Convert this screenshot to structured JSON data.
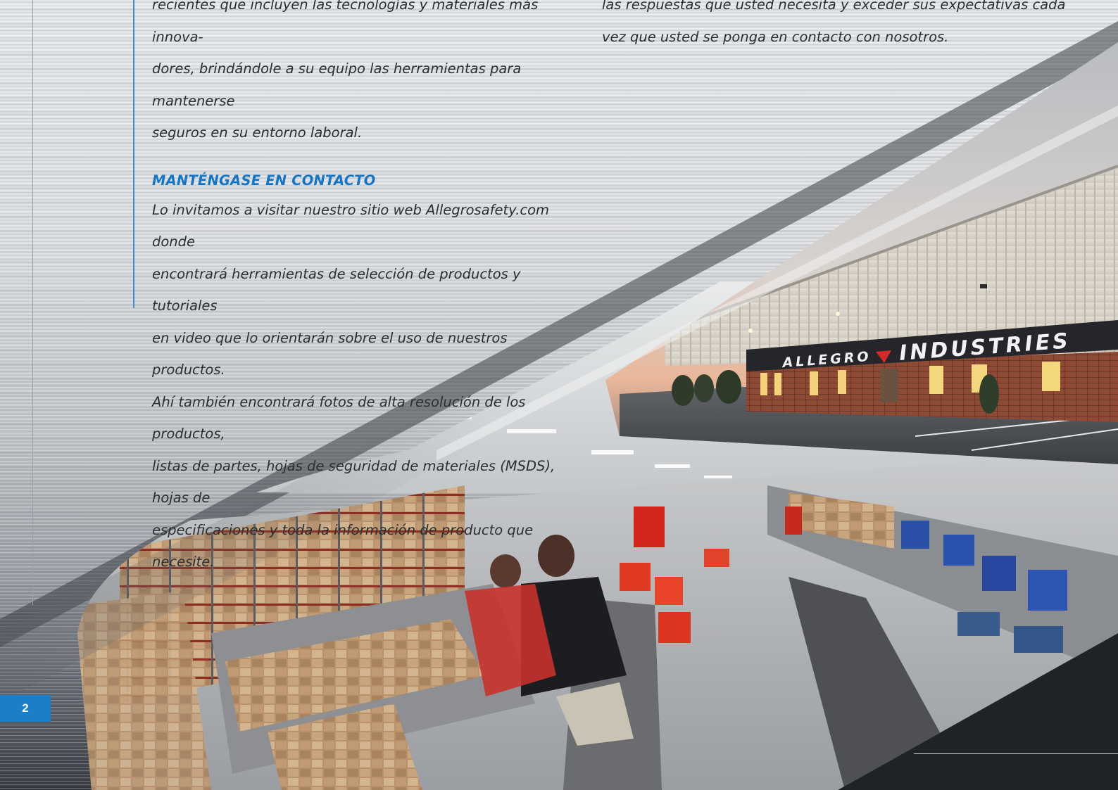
{
  "page_number": "2",
  "left_column": {
    "paragraph_1_lines": [
      "recientes que incluyen las tecnologías y materiales más innova-",
      "dores, brindándole a su equipo las herramientas para mantenerse",
      "seguros en su entorno laboral."
    ],
    "heading": "MANTÉNGASE EN CONTACTO",
    "paragraph_2_lines": [
      "Lo invitamos a visitar nuestro sitio web Allegrosafety.com donde",
      "encontrará herramientas de selección de productos y tutoriales",
      "en video que lo orientarán sobre el uso de nuestros productos.",
      "Ahí también encontrará fotos de alta resolución de los productos,",
      "listas de partes, hojas de seguridad de materiales (MSDS), hojas de",
      "especificaciones y toda la información de producto que necesite."
    ]
  },
  "right_column": {
    "lines": [
      "las respuestas que usted necesita y exceder sus expectativas cada",
      "vez que usted se ponga en contacto con nosotros."
    ]
  },
  "building_sign": {
    "left_word": "ALLEGRO",
    "right_word": "INDUSTRIES"
  },
  "colors": {
    "accent_blue": "#1a7ec9",
    "heading_blue": "#1476c8",
    "logo_red": "#d62a2a"
  }
}
